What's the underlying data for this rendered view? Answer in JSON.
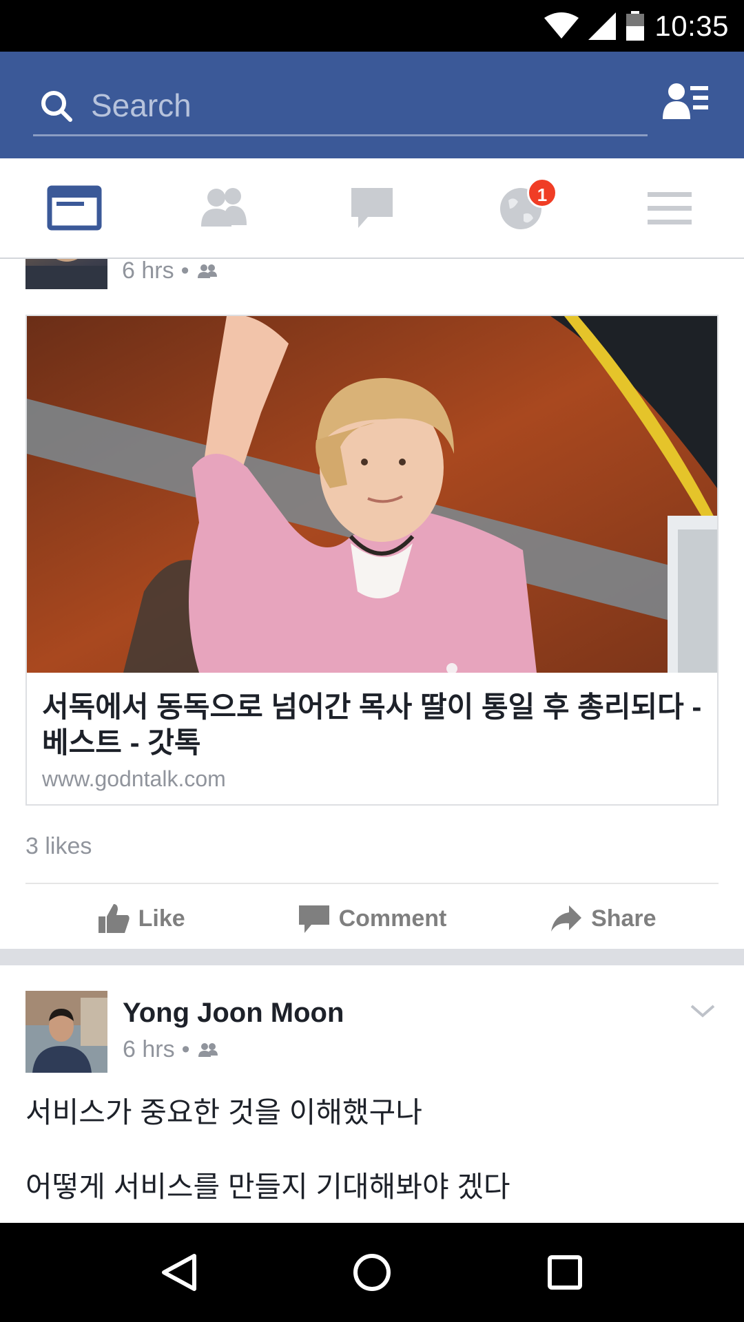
{
  "status_bar": {
    "time": "10:35"
  },
  "header": {
    "search_placeholder": "Search"
  },
  "tabs": [
    {
      "name": "news-feed",
      "active": true
    },
    {
      "name": "friend-requests",
      "active": false
    },
    {
      "name": "messages",
      "active": false
    },
    {
      "name": "notifications",
      "active": false,
      "badge": "1"
    },
    {
      "name": "more",
      "active": false
    }
  ],
  "feed": {
    "post1": {
      "time": "6 hrs",
      "link": {
        "title": "서독에서 동독으로 넘어간 목사 딸이 통일 후 총리되다 - 베스트 - 갓톡",
        "domain": "www.godntalk.com"
      },
      "likes": "3 likes",
      "actions": {
        "like": "Like",
        "comment": "Comment",
        "share": "Share"
      }
    },
    "post2": {
      "author": "Yong Joon Moon",
      "time": "6 hrs",
      "text_lines": [
        "서비스가 중요한 것을 이해했구나",
        "어떻게 서비스를 만들지 기대해봐야 겠다"
      ]
    }
  },
  "colors": {
    "brand_blue": "#3b5998",
    "badge_red": "#f03d25",
    "muted_text": "#90949c"
  }
}
